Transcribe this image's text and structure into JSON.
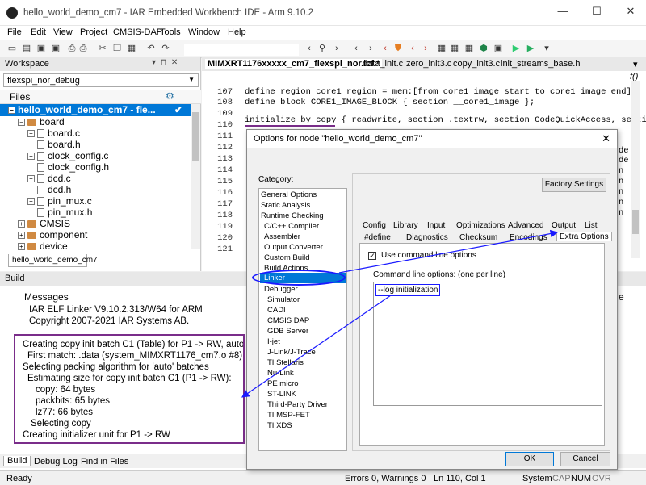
{
  "window": {
    "title": "hello_world_demo_cm7 - IAR Embedded Workbench IDE - Arm 9.10.2",
    "minimize": "—",
    "maximize": "☐",
    "close": "✕"
  },
  "menu": [
    "File",
    "Edit",
    "View",
    "Project",
    "CMSIS-DAP",
    "Tools",
    "Window",
    "Help"
  ],
  "workspace": {
    "header": "Workspace",
    "config": "flexspi_nor_debug",
    "files_label": "Files",
    "project": "hello_world_demo_cm7 - fle...",
    "tab": "hello_world_demo_cm7",
    "tree": [
      "board",
      "board.c",
      "board.h",
      "clock_config.c",
      "clock_config.h",
      "dcd.c",
      "dcd.h",
      "pin_mux.c",
      "pin_mux.h",
      "CMSIS",
      "component",
      "device"
    ]
  },
  "editor": {
    "tabs": [
      "MIMXRT1176xxxxx_cm7_flexspi_nor.icf *",
      "data_init.c",
      "zero_init3.c",
      "copy_init3.c",
      "init_streams_base.h"
    ],
    "func_btn": "f()",
    "line_numbers": [
      "107",
      "108",
      "109",
      "110",
      "111",
      "112",
      "113",
      "114",
      "115",
      "116",
      "117",
      "118",
      "119",
      "120",
      "121",
      "122"
    ],
    "lines": [
      "define region core1_region = mem:[from core1_image_start to core1_image_end];",
      "define block CORE1_IMAGE_BLOCK          { section  __core1_image };",
      "",
      "initialize by copy { readwrite, section .textrw, section CodeQuickAccess, section D"
    ],
    "right_fragments": [
      "de",
      "de",
      "n",
      "n",
      "n",
      "n",
      "n"
    ]
  },
  "build": {
    "header": "Build",
    "messages_label": "Messages",
    "linker_info": [
      "IAR ELF Linker V9.10.2.313/W64 for ARM",
      "Copyright 2007-2021 IAR Systems AB."
    ],
    "log": [
      "Creating copy init batch C1 (Table) for P1 -> RW, auto, uni",
      "First match: .data (system_MIMXRT1176_cm7.o #8)",
      "Selecting packing algorithm for 'auto' batches",
      "Estimating size for copy init batch C1 (P1 -> RW):",
      "copy: 64 bytes",
      "packbits: 65 bytes",
      "lz77: 66 bytes",
      "Selecting copy",
      "Creating initializer unit for P1 -> RW"
    ],
    "bottom_tabs": [
      "Build",
      "Debug Log",
      "Find in Files"
    ],
    "right_fragment": "e"
  },
  "status": {
    "left": "Ready",
    "errors": "Errors 0, Warnings 0",
    "pos": "Ln 110, Col 1",
    "system": "System",
    "cap": "CAP",
    "num": "NUM",
    "ovr": "OVR"
  },
  "dialog": {
    "title": "Options for node \"hello_world_demo_cm7\"",
    "category_label": "Category:",
    "categories": [
      "General Options",
      "Static Analysis",
      "Runtime Checking",
      "C/C++ Compiler",
      "Assembler",
      "Output Converter",
      "Custom Build",
      "Build Actions",
      "Linker",
      "Debugger",
      "Simulator",
      "CADI",
      "CMSIS DAP",
      "GDB Server",
      "I-jet",
      "J-Link/J-Trace",
      "TI Stellaris",
      "Nu-Link",
      "PE micro",
      "ST-LINK",
      "Third-Party Driver",
      "TI MSP-FET",
      "TI XDS"
    ],
    "factory": "Factory Settings",
    "tabs_row1": [
      "Config",
      "Library",
      "Input",
      "Optimizations",
      "Advanced",
      "Output",
      "List"
    ],
    "tabs_row2": [
      "#define",
      "Diagnostics",
      "Checksum",
      "Encodings",
      "Extra Options"
    ],
    "use_cmd": "Use command line options",
    "cmd_label": "Command line options:  (one per line)",
    "cmd_value": "--log initialization",
    "ok": "OK",
    "cancel": "Cancel"
  },
  "colors": {
    "annotation_blue": "#1a1aff",
    "annotation_purple": "#7a2d8a",
    "selection": "#0078d7"
  }
}
